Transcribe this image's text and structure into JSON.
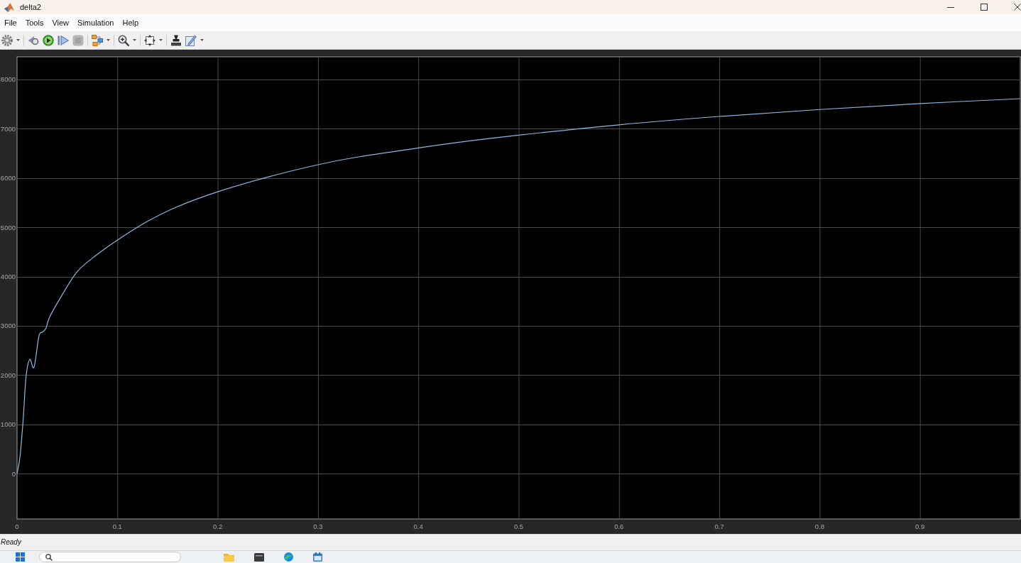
{
  "window": {
    "title": "delta2"
  },
  "menu": [
    "File",
    "Tools",
    "View",
    "Simulation",
    "Help"
  ],
  "toolbar": [
    {
      "items": [
        {
          "kind": "settings",
          "dropdown": true,
          "disabled": false
        }
      ]
    },
    {
      "items": [
        {
          "kind": "step-back",
          "dropdown": false,
          "disabled": false
        },
        {
          "kind": "run",
          "dropdown": false,
          "disabled": false
        },
        {
          "kind": "step-forward",
          "dropdown": false,
          "disabled": false
        },
        {
          "kind": "stop",
          "dropdown": false,
          "disabled": true
        }
      ]
    },
    {
      "items": [
        {
          "kind": "signals",
          "dropdown": true,
          "disabled": false
        }
      ]
    },
    {
      "items": [
        {
          "kind": "zoom",
          "dropdown": true,
          "disabled": false
        }
      ]
    },
    {
      "items": [
        {
          "kind": "fit",
          "dropdown": true,
          "disabled": false
        }
      ]
    },
    {
      "items": [
        {
          "kind": "stamp",
          "dropdown": false,
          "disabled": false
        },
        {
          "kind": "style",
          "dropdown": true,
          "disabled": false
        }
      ]
    }
  ],
  "scope": {
    "chart_data": {
      "type": "line",
      "grid": true,
      "x": [
        0,
        0.003,
        0.006,
        0.009,
        0.0127,
        0.0169,
        0.0218,
        0.0253,
        0.0288,
        0.0323,
        0.043,
        0.06,
        0.08,
        0.1,
        0.13,
        0.16,
        0.2,
        0.25,
        0.3,
        0.335,
        0.4,
        0.45,
        0.5,
        0.6,
        0.7,
        0.8,
        0.9,
        1
      ],
      "series": [
        {
          "color": "#8cb8e2",
          "values": [
            0,
            350,
            1070,
            1970,
            2320,
            2160,
            2790,
            2870,
            2950,
            3170,
            3560,
            4100,
            4450,
            4740,
            5120,
            5420,
            5720,
            6020,
            6270,
            6410,
            6610,
            6750,
            6870,
            7080,
            7250,
            7390,
            7510,
            7610
          ]
        }
      ],
      "xlim": [
        0,
        1
      ],
      "ylim": [
        -920,
        8460
      ],
      "xticks": [
        0,
        0.1,
        0.2,
        0.3,
        0.4,
        0.5,
        0.6,
        0.7,
        0.8,
        0.9
      ],
      "yticks": [
        0,
        1000,
        2000,
        3000,
        4000,
        5000,
        6000,
        7000,
        8000
      ]
    }
  },
  "status_bar": "Ready"
}
